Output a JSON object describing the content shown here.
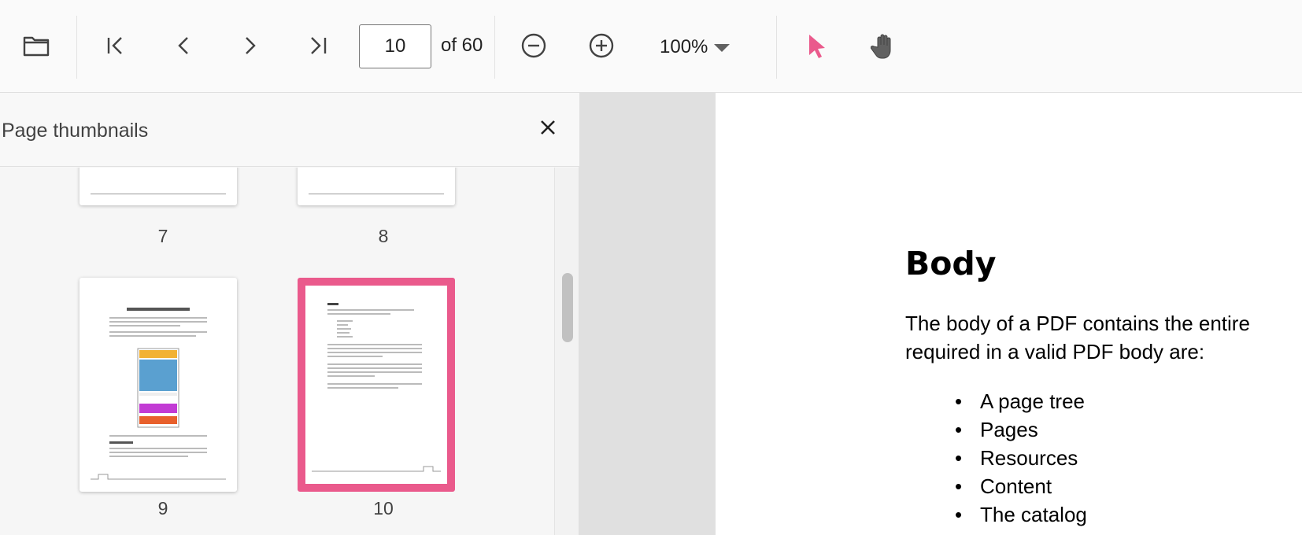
{
  "toolbar": {
    "current_page": "10",
    "page_total": "of 60",
    "zoom_level": "100%",
    "icons": [
      "folder-open-icon",
      "first-page-icon",
      "previous-page-icon",
      "next-page-icon",
      "last-page-icon",
      "zoom-out-icon",
      "zoom-in-icon",
      "selection-tool-icon",
      "pan-tool-icon"
    ],
    "accent_color": "#ea5a8c"
  },
  "thumbnail_panel": {
    "title": "Page thumbnails",
    "thumbnails": [
      {
        "page": "7"
      },
      {
        "page": "8"
      },
      {
        "page": "9"
      },
      {
        "page": "10",
        "selected": true
      }
    ]
  },
  "document": {
    "heading": "Body",
    "paragraph_line1": "The body of a PDF contains the entire",
    "paragraph_line2": "required in a valid PDF body are:",
    "list_items": [
      "A page tree",
      "Pages",
      "Resources",
      "Content",
      "The catalog"
    ]
  }
}
